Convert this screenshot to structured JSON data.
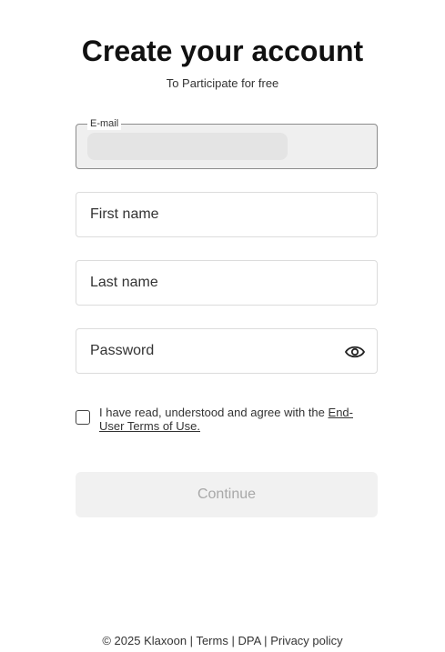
{
  "header": {
    "title": "Create your account",
    "subtitle": "To Participate for free"
  },
  "form": {
    "email": {
      "label": "E-mail",
      "value": ""
    },
    "first_name": {
      "placeholder": "First name",
      "value": ""
    },
    "last_name": {
      "placeholder": "Last name",
      "value": ""
    },
    "password": {
      "placeholder": "Password",
      "value": "",
      "toggle_icon": "eye-icon"
    },
    "terms": {
      "text_before": "I have read, understood and agree with the",
      "link_text": "End-User Terms of Use.",
      "checked": false
    },
    "continue_label": "Continue"
  },
  "footer": {
    "copyright": "© 2025 Klaxoon",
    "sep1": "|",
    "terms_link": "Terms",
    "sep2": "|",
    "dpa_link": "DPA",
    "sep3": "|",
    "privacy_link": "Privacy policy"
  },
  "colors": {
    "button_disabled_bg": "#f1f1f1",
    "button_disabled_text": "#a8a8a8",
    "email_field_bg": "#efefef"
  }
}
